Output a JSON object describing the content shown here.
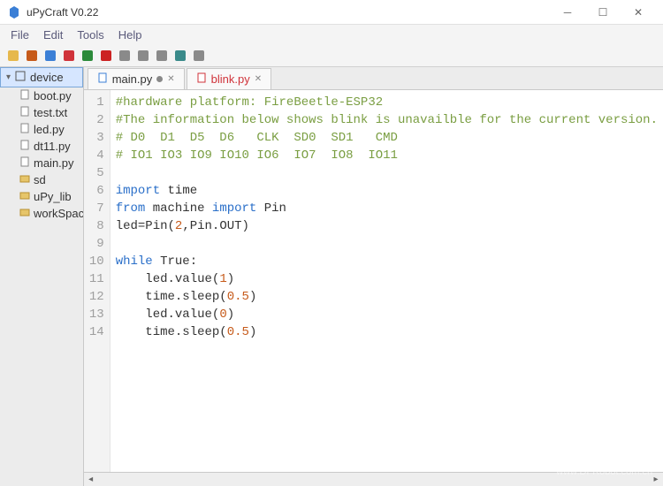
{
  "window": {
    "title": "uPyCraft V0.22"
  },
  "menu": {
    "items": [
      "File",
      "Edit",
      "Tools",
      "Help"
    ]
  },
  "toolbar": {
    "icons": [
      {
        "name": "new-icon",
        "color": "#e6b84c"
      },
      {
        "name": "open-icon",
        "color": "#c65a1a"
      },
      {
        "name": "save-icon",
        "color": "#3b7fd6"
      },
      {
        "name": "download-icon",
        "color": "#d0333a"
      },
      {
        "name": "run-icon",
        "color": "#2c8a3a"
      },
      {
        "name": "stop-icon",
        "color": "#c22"
      },
      {
        "name": "connect-icon",
        "color": "#8a8a8a"
      },
      {
        "name": "undo-icon",
        "color": "#8a8a8a"
      },
      {
        "name": "redo-icon",
        "color": "#8a8a8a"
      },
      {
        "name": "check-icon",
        "color": "#3a8a8a"
      },
      {
        "name": "clear-icon",
        "color": "#8a8a8a"
      }
    ]
  },
  "tree": {
    "root": "device",
    "children": [
      {
        "label": "boot.py",
        "icon": "py"
      },
      {
        "label": "test.txt",
        "icon": "txt"
      },
      {
        "label": "led.py",
        "icon": "py"
      },
      {
        "label": "dt11.py",
        "icon": "py"
      },
      {
        "label": "main.py",
        "icon": "py"
      },
      {
        "label": "sd",
        "icon": "folder"
      },
      {
        "label": "uPy_lib",
        "icon": "folder"
      },
      {
        "label": "workSpace",
        "icon": "folder"
      }
    ]
  },
  "tabs": [
    {
      "label": "main.py",
      "active": false,
      "dirty": true
    },
    {
      "label": "blink.py",
      "active": true,
      "dirty": false
    }
  ],
  "code": {
    "lines": [
      {
        "n": 1,
        "t": "comment",
        "text": "#hardware platform: FireBeetle-ESP32"
      },
      {
        "n": 2,
        "t": "comment",
        "text": "#The information below shows blink is unavailble for the current version."
      },
      {
        "n": 3,
        "t": "comment",
        "text": "# D0  D1  D5  D6   CLK  SD0  SD1   CMD"
      },
      {
        "n": 4,
        "t": "comment",
        "text": "# IO1 IO3 IO9 IO10 IO6  IO7  IO8  IO11"
      },
      {
        "n": 5,
        "t": "blank",
        "text": ""
      },
      {
        "n": 6,
        "t": "import",
        "kw": "import",
        "rest": " time"
      },
      {
        "n": 7,
        "t": "fromimport",
        "kw1": "from",
        "mid": " machine ",
        "kw2": "import",
        "rest": " Pin"
      },
      {
        "n": 8,
        "t": "assign",
        "pre": "led=Pin(",
        "num1": "2",
        "mid": ",Pin.OUT)",
        "post": ""
      },
      {
        "n": 9,
        "t": "blank",
        "text": ""
      },
      {
        "n": 10,
        "t": "while",
        "kw": "while",
        "rest": " True:"
      },
      {
        "n": 11,
        "t": "call",
        "indent": "    ",
        "pre": "led.value(",
        "num": "1",
        "post": ")"
      },
      {
        "n": 12,
        "t": "call",
        "indent": "    ",
        "pre": "time.sleep(",
        "num": "0.5",
        "post": ")"
      },
      {
        "n": 13,
        "t": "call",
        "indent": "    ",
        "pre": "led.value(",
        "num": "0",
        "post": ")"
      },
      {
        "n": 14,
        "t": "call",
        "indent": "    ",
        "pre": "time.sleep(",
        "num": "0.5",
        "post": ")"
      }
    ]
  },
  "watermark": {
    "line1": "DF创客社区",
    "line2": "www.DFRobot.com.cn"
  }
}
